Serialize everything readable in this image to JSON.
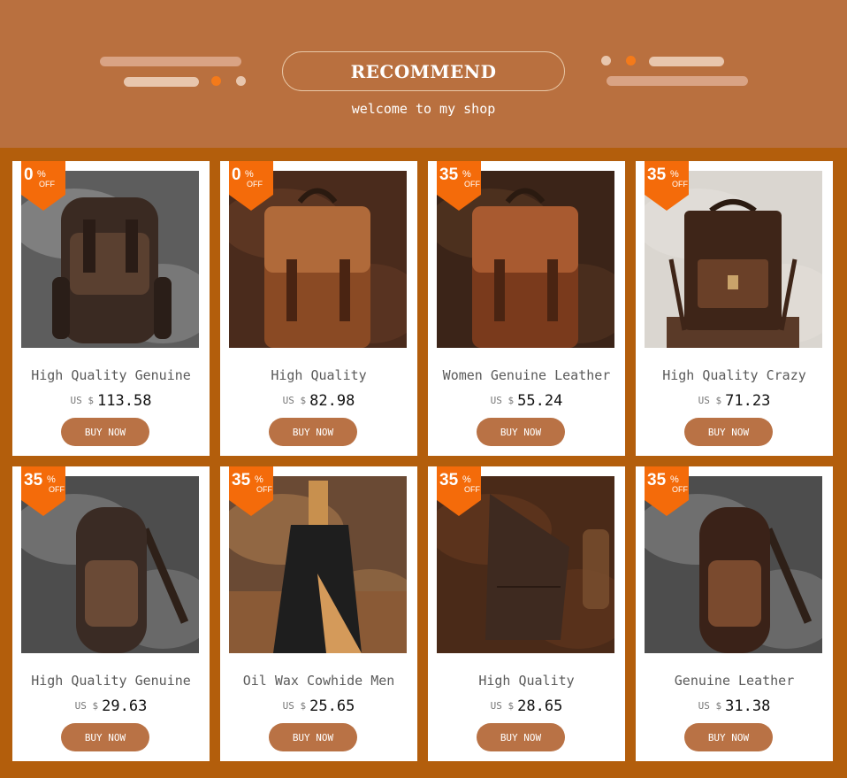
{
  "header": {
    "title": "RECOMMEND",
    "subtitle": "welcome to my shop"
  },
  "colors": {
    "header_bg": "#b9703f",
    "grid_bg": "#b35e0c",
    "badge": "#f46b0a",
    "button": "#b97245",
    "accent_dot": "#f47a1a"
  },
  "products": [
    {
      "discount": "0",
      "pct": "%",
      "off": "OFF",
      "name": "High Quality Genuine",
      "currency": "US $",
      "price": "113.58",
      "button": "BUY NOW"
    },
    {
      "discount": "0",
      "pct": "%",
      "off": "OFF",
      "name": "High Quality",
      "currency": "US $",
      "price": "82.98",
      "button": "BUY NOW"
    },
    {
      "discount": "35",
      "pct": "%",
      "off": "OFF",
      "name": "Women Genuine Leather",
      "currency": "US $",
      "price": "55.24",
      "button": "BUY NOW"
    },
    {
      "discount": "35",
      "pct": "%",
      "off": "OFF",
      "name": "High Quality Crazy",
      "currency": "US $",
      "price": "71.23",
      "button": "BUY NOW"
    },
    {
      "discount": "35",
      "pct": "%",
      "off": "OFF",
      "name": "High Quality Genuine",
      "currency": "US $",
      "price": "29.63",
      "button": "BUY NOW"
    },
    {
      "discount": "35",
      "pct": "%",
      "off": "OFF",
      "name": "Oil Wax Cowhide Men",
      "currency": "US $",
      "price": "25.65",
      "button": "BUY NOW"
    },
    {
      "discount": "35",
      "pct": "%",
      "off": "OFF",
      "name": "High Quality",
      "currency": "US $",
      "price": "28.65",
      "button": "BUY NOW"
    },
    {
      "discount": "35",
      "pct": "%",
      "off": "OFF",
      "name": "Genuine Leather",
      "currency": "US $",
      "price": "31.38",
      "button": "BUY NOW"
    }
  ]
}
